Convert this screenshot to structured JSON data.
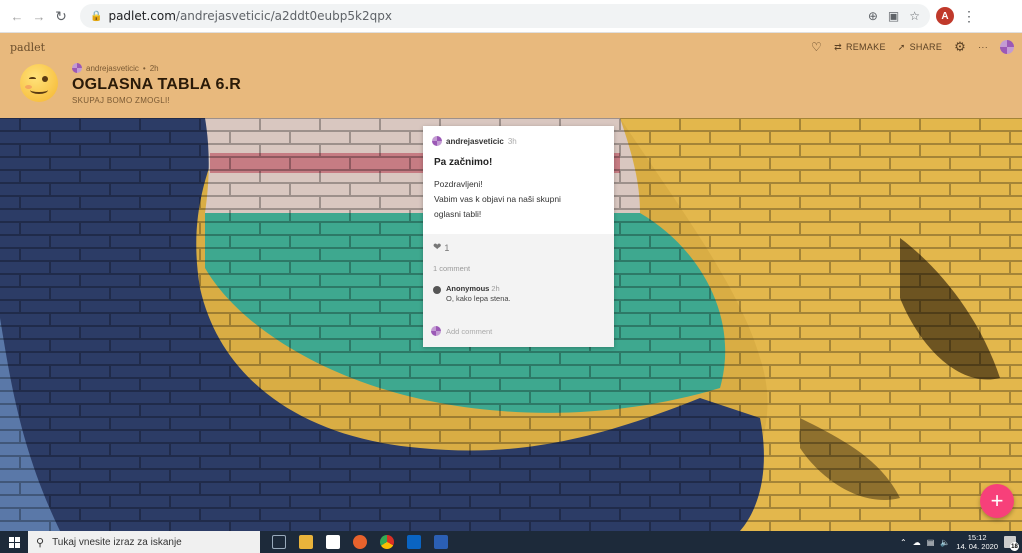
{
  "browser": {
    "url_domain": "padlet.com",
    "url_path": "/andrejasveticic/a2ddt0eubp5k2qpx",
    "profile_initial": "A",
    "icons": [
      "back-icon",
      "forward-icon",
      "reload-icon",
      "lock-icon",
      "extension-icon",
      "translate-icon",
      "star-icon",
      "kebab-menu-icon"
    ]
  },
  "padlet": {
    "brand": "padlet",
    "actions": {
      "remake": "REMAKE",
      "share": "SHARE",
      "more": "···"
    },
    "author": "andrejasveticic",
    "author_time": "2h",
    "title": "OGLASNA TABLA 6.R",
    "subtitle": "SKUPAJ BOMO ZMOGLI!",
    "accent": "#e8b97d"
  },
  "post": {
    "author": "andrejasveticic",
    "time": "3h",
    "title": "Pa začnimo!",
    "body_lines": [
      "Pozdravljeni!",
      "Vabim vas k objavi na naši skupni",
      "oglasni tabli!"
    ],
    "likes": "1",
    "comments_count": "1 comment",
    "comment": {
      "author": "Anonymous",
      "time": "2h",
      "text": "O, kako lepa stena."
    },
    "add_comment_placeholder": "Add comment"
  },
  "fab": {
    "label": "+",
    "color": "#f7407a"
  },
  "taskbar": {
    "search_placeholder": "Tukaj vnesite izraz za iskanje",
    "time": "15:12",
    "date": "14. 04. 2020",
    "notification_count": "18"
  }
}
